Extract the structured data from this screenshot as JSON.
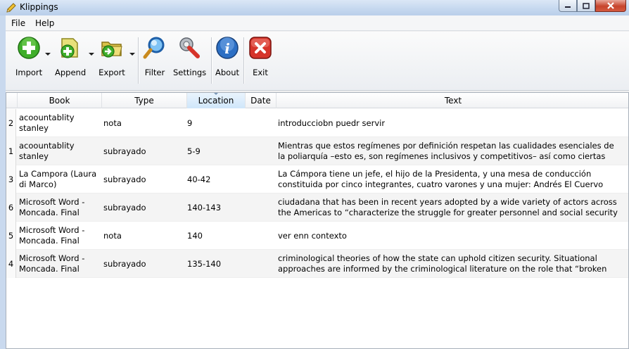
{
  "window": {
    "title": "Klippings"
  },
  "menu": {
    "file": "File",
    "help": "Help"
  },
  "toolbar": {
    "import": "Import",
    "append": "Append",
    "export": "Export",
    "filter": "Filter",
    "settings": "Settings",
    "about": "About",
    "exit": "Exit"
  },
  "table": {
    "columns": {
      "book": "Book",
      "type": "Type",
      "location": "Location",
      "date": "Date",
      "text": "Text"
    },
    "sorted_column": "Location",
    "rows": [
      {
        "num": "2",
        "book": "acoountablity stanley (marianorodrigo@...",
        "type": "nota",
        "location": "9",
        "date": "",
        "text": "introducciobn puedr servir"
      },
      {
        "num": "1",
        "book": "acoountablity stanley (marianorodrigo@...",
        "type": "subrayado",
        "location": "5-9",
        "date": "",
        "text": "Mientras que estos regímenes por definición respetan las cualidades esenciales de la poliarquía –esto es, son regímenes inclusivos y competitivos– así como ciertas garantías li..."
      },
      {
        "num": "3",
        "book": "La Campora (Laura di Marco)",
        "type": "subrayado",
        "location": "40-42",
        "date": "",
        "text": "La Cámpora tiene un jefe, el hijo de la Presidenta, y una mesa de conducción constituida por cinco integrantes, cuatro varones y una mujer: Andrés El Cuervo Larroque, su secretario ge..."
      },
      {
        "num": "6",
        "book": "Microsoft Word - Moncada. Final Dis...",
        "type": "subrayado",
        "location": "140-143",
        "date": "",
        "text": "ciudadana that has been in recent years adopted by a wide variety of actors across the Americas to “characterize the struggle for greater personnel and social security guaranteed..."
      },
      {
        "num": "5",
        "book": "Microsoft Word - Moncada. Final Dis...",
        "type": "nota",
        "location": "140",
        "date": "",
        "text": "ver enn  contexto"
      },
      {
        "num": "4",
        "book": "Microsoft Word - Moncada. Final Dis...",
        "type": "subrayado",
        "location": "135-140",
        "date": "",
        "text": "criminological theories of how the state can uphold citizen security. Situational approaches are informed by the criminological literature on the role that “broken windows” (Kelling an..."
      }
    ]
  },
  "icons": {
    "app": "pencil-icon",
    "import": "plus-icon",
    "append": "document-plus-icon",
    "export": "folder-arrow-icon",
    "filter": "magnifier-icon",
    "settings": "wrench-icon",
    "about": "info-icon",
    "exit": "close-icon"
  },
  "colors": {
    "import": "#3fae2a",
    "append": "#c8c23a",
    "export": "#d9c24a",
    "filter": "#2f7fd6",
    "about": "#2c6fc4",
    "exit": "#d6342a"
  }
}
